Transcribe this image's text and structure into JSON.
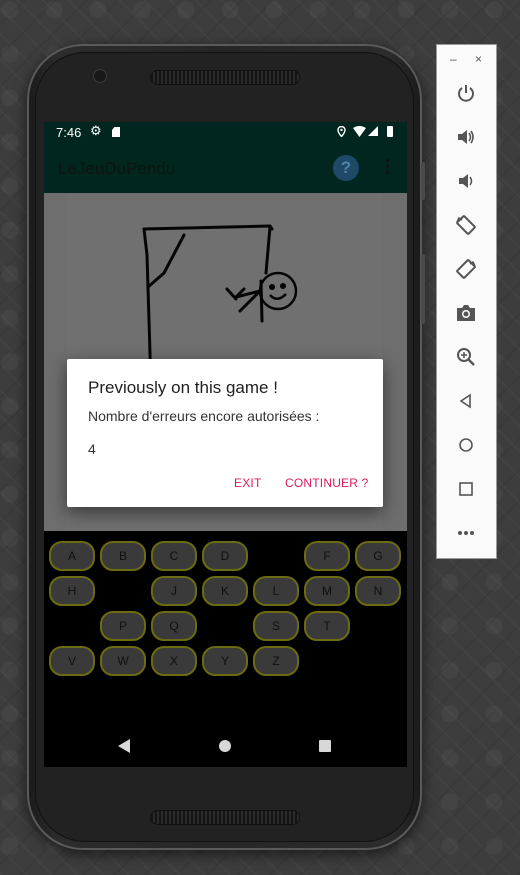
{
  "status_bar": {
    "time": "7:46",
    "gear_icon": "gear-icon",
    "sd_card_icon": "sd-card-icon",
    "location_icon": "location-icon",
    "wifi_icon": "wifi-icon",
    "signal_icon": "signal-icon",
    "battery_icon": "battery-icon"
  },
  "app_bar": {
    "title": "LeJeuDuPendu",
    "help_symbol": "?",
    "overflow_icon": "more-vert-icon",
    "color": "#00261f"
  },
  "dialog": {
    "title": "Previously on this game !",
    "message": "Nombre d'erreurs encore autorisées :",
    "value": "4",
    "button_exit": "EXIT",
    "button_continue": "CONTINUER ?",
    "accent_color": "#d81b60"
  },
  "keyboard": {
    "row1": [
      "A",
      "B",
      "C",
      "D",
      "",
      "F",
      "G"
    ],
    "row2": [
      "H",
      "",
      "J",
      "K",
      "L",
      "M",
      "N"
    ],
    "row3": [
      "",
      "P",
      "Q",
      "",
      "S",
      "T",
      ""
    ],
    "row4": [
      "V",
      "W",
      "X",
      "Y",
      "Z",
      "",
      ""
    ],
    "key_border_color": "#6b6b12"
  },
  "nav_bar": {
    "back_icon": "back-triangle-icon",
    "home_icon": "home-circle-icon",
    "recents_icon": "recents-square-icon"
  },
  "emulator_panel": {
    "minimize": "–",
    "close": "×",
    "tools": [
      "power-icon",
      "volume-up-icon",
      "volume-down-icon",
      "rotate-left-icon",
      "rotate-right-icon",
      "camera-icon",
      "zoom-icon",
      "back-icon",
      "home-icon",
      "overview-icon",
      "more-icon"
    ]
  }
}
